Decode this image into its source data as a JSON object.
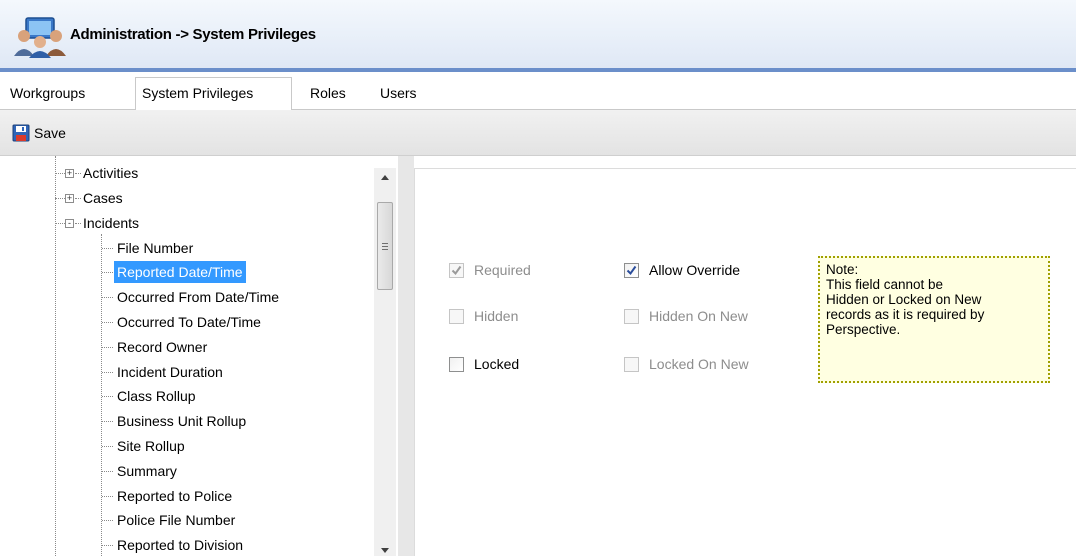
{
  "window": {
    "title": "Administration -> System Privileges"
  },
  "tabs": [
    {
      "label": "Workgroups",
      "active": false
    },
    {
      "label": "System Privileges",
      "active": true
    },
    {
      "label": "Roles",
      "active": false
    },
    {
      "label": "Users",
      "active": false
    }
  ],
  "toolbar": {
    "save_label": "Save"
  },
  "tree": {
    "groups": [
      {
        "label": "Activities",
        "expander": "+"
      },
      {
        "label": "Cases",
        "expander": "+"
      },
      {
        "label": "Incidents",
        "expander": "-"
      }
    ],
    "children": [
      "File Number",
      "Reported Date/Time",
      "Occurred From Date/Time",
      "Occurred To Date/Time",
      "Record Owner",
      "Incident Duration",
      "Class Rollup",
      "Business Unit Rollup",
      "Site Rollup",
      "Summary",
      "Reported to Police",
      "Police File Number",
      "Reported to Division"
    ],
    "selected": "Reported Date/Time"
  },
  "options": {
    "required": {
      "label": "Required",
      "checked": true,
      "enabled": false
    },
    "hidden": {
      "label": "Hidden",
      "checked": false,
      "enabled": false
    },
    "locked": {
      "label": "Locked",
      "checked": false,
      "enabled": true
    },
    "allow_override": {
      "label": "Allow Override",
      "checked": true,
      "enabled": true
    },
    "hidden_on_new": {
      "label": "Hidden On New",
      "checked": false,
      "enabled": false
    },
    "locked_on_new": {
      "label": "Locked On New",
      "checked": false,
      "enabled": false
    }
  },
  "note": {
    "lines": [
      "Note:",
      "This field cannot be",
      "Hidden or Locked on New",
      "records as it is required by",
      "Perspective."
    ]
  },
  "colors": {
    "selection": "#3399ff",
    "note_background": "#ffffe1",
    "title_accent": "#6b8fca"
  }
}
